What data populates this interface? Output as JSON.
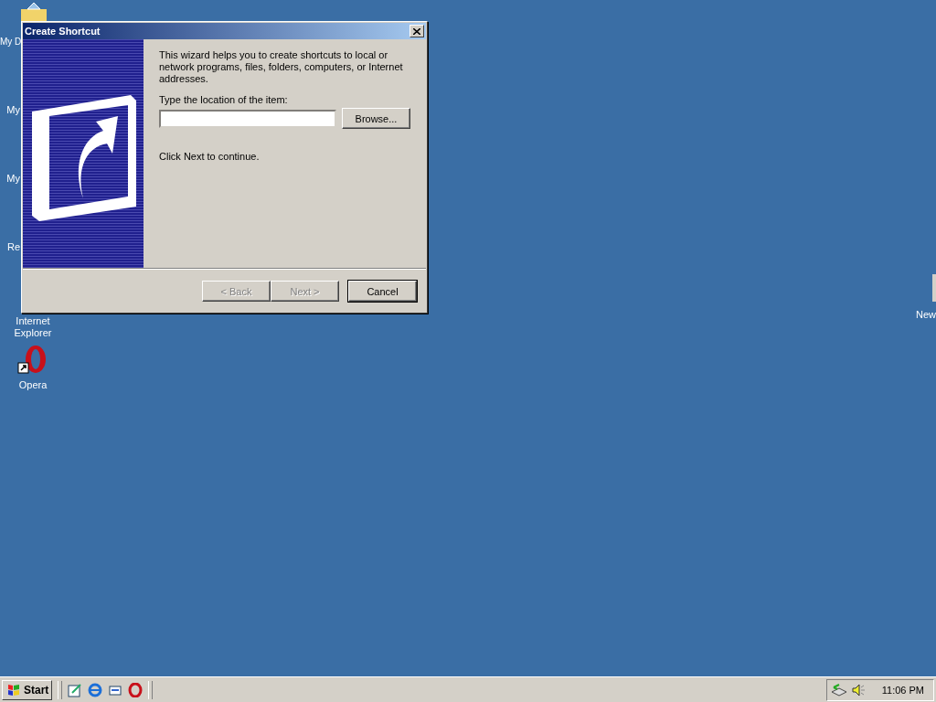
{
  "desktop_icons": [
    {
      "label": "My D",
      "kind": "folder"
    },
    {
      "label": "My",
      "kind": "covered"
    },
    {
      "label": "My",
      "kind": "covered"
    },
    {
      "label": "Re",
      "kind": "covered"
    },
    {
      "label": "Internet Explorer",
      "kind": "covered"
    },
    {
      "label": "Opera",
      "kind": "opera"
    },
    {
      "label": "New",
      "kind": "covered"
    }
  ],
  "dialog": {
    "title": "Create Shortcut",
    "intro": "This wizard helps you to create shortcuts to local or network programs, files, folders, computers, or Internet addresses.",
    "location_label": "Type the location of the item:",
    "browse": "Browse...",
    "hint": "Click Next to continue.",
    "buttons": [
      {
        "label": "< Back",
        "disabled": true,
        "default": false
      },
      {
        "label": "Next >",
        "disabled": true,
        "default": false
      },
      {
        "label": "Cancel",
        "disabled": false,
        "default": true
      }
    ]
  },
  "taskbar": {
    "start": "Start",
    "clock": "11:06 PM"
  }
}
